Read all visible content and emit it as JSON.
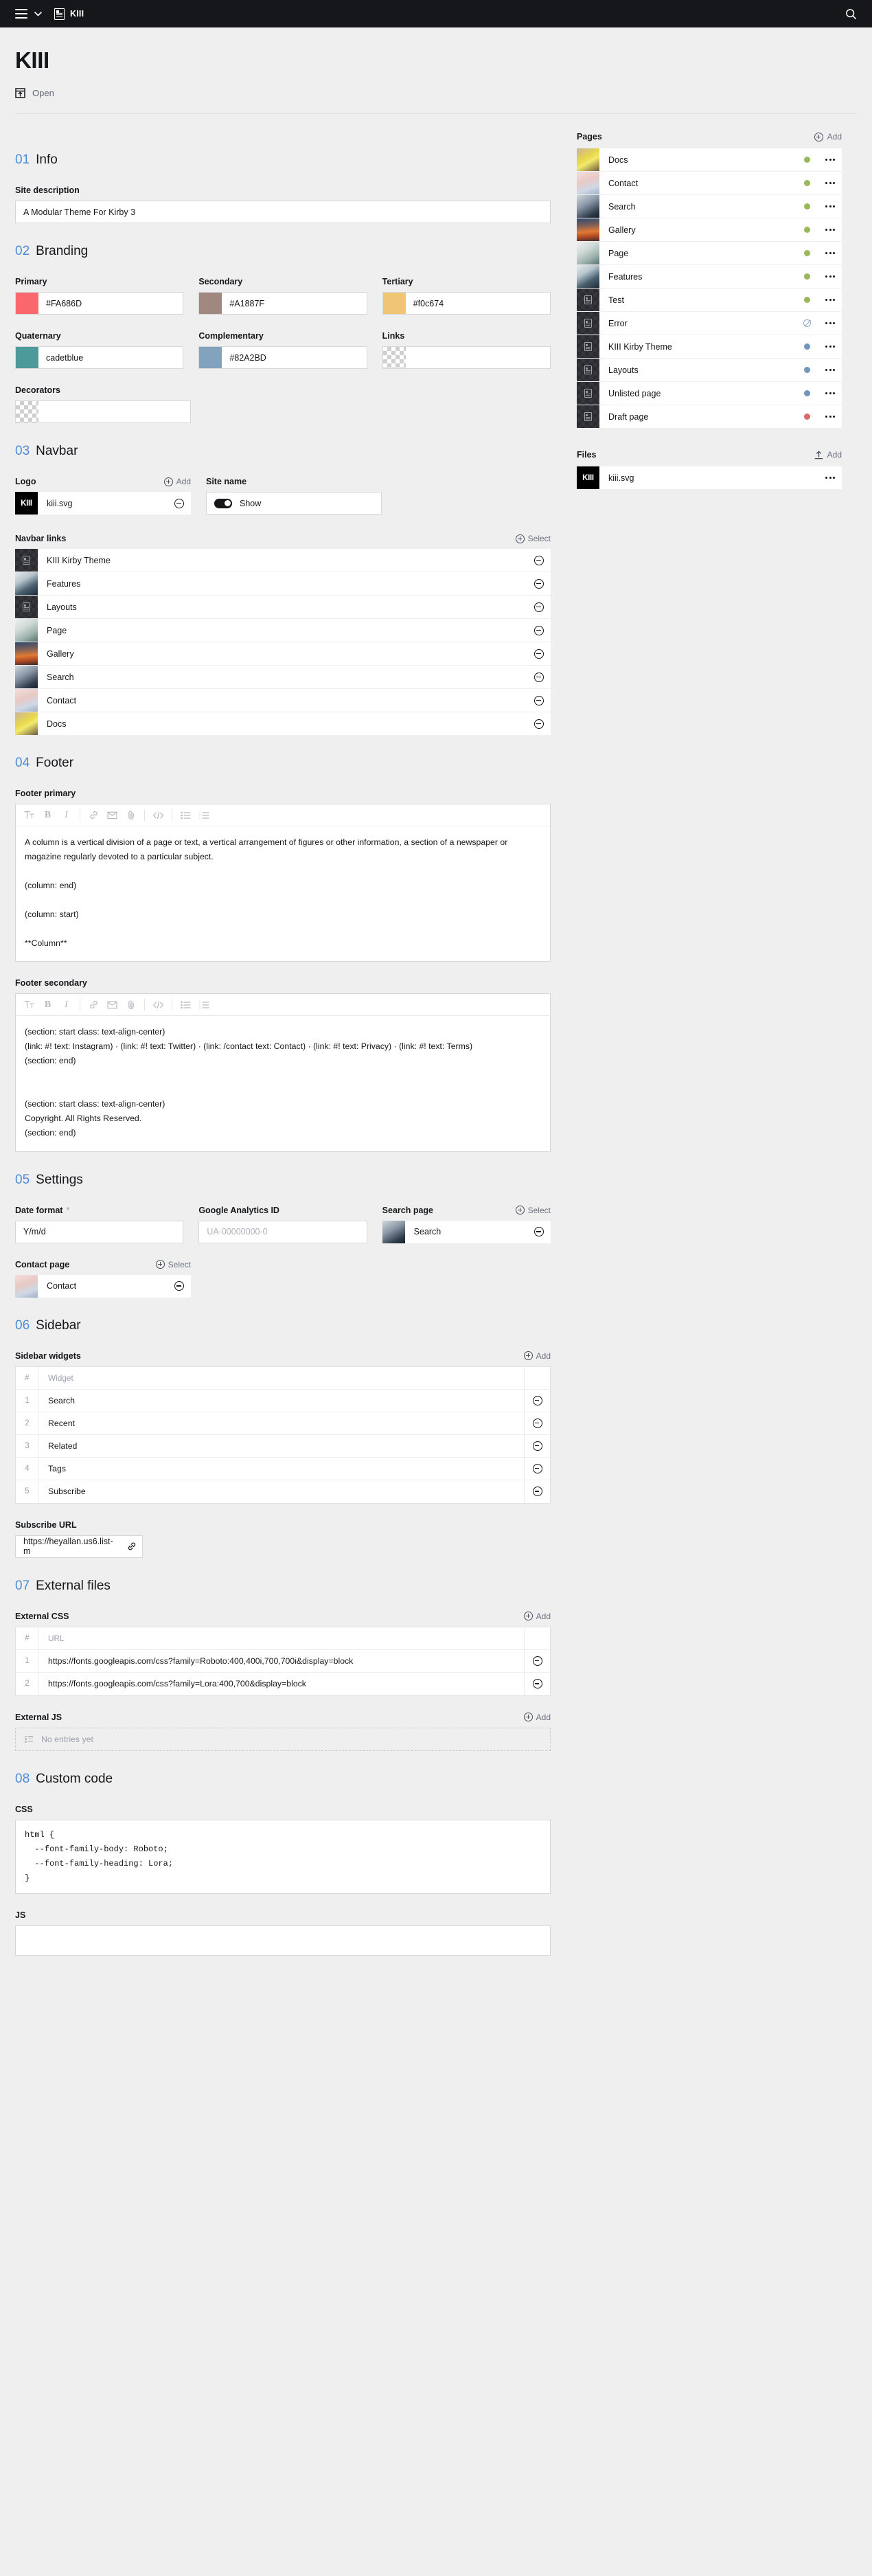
{
  "topbar": {
    "menu_icon": "hamburger-icon",
    "chevron_icon": "chevron-down-icon",
    "breadcrumb_icon": "page-document-icon",
    "breadcrumb_label": "KIII",
    "search_icon": "search-icon"
  },
  "header": {
    "title": "KIII",
    "open_icon": "open-external-icon",
    "open_label": "Open"
  },
  "sections": {
    "info": {
      "num": "01",
      "name": "Info"
    },
    "branding": {
      "num": "02",
      "name": "Branding"
    },
    "navbar": {
      "num": "03",
      "name": "Navbar"
    },
    "footer": {
      "num": "04",
      "name": "Footer"
    },
    "settings": {
      "num": "05",
      "name": "Settings"
    },
    "sidebar": {
      "num": "06",
      "name": "Sidebar"
    },
    "external": {
      "num": "07",
      "name": "External files"
    },
    "customcode": {
      "num": "08",
      "name": "Custom code"
    }
  },
  "info": {
    "site_description_label": "Site description",
    "site_description_value": "A Modular Theme For Kirby 3"
  },
  "branding": {
    "colors": [
      {
        "label": "Primary",
        "value": "#FA686D",
        "swatch": "#FA686D",
        "empty": false
      },
      {
        "label": "Secondary",
        "value": "#A1887F",
        "swatch": "#A1887F",
        "empty": false
      },
      {
        "label": "Tertiary",
        "value": "#f0c674",
        "swatch": "#F0C674",
        "empty": false
      },
      {
        "label": "Quaternary",
        "value": "cadetblue",
        "swatch": "#4E9A9A",
        "empty": false
      },
      {
        "label": "Complementary",
        "value": "#82A2BD",
        "swatch": "#82A2BD",
        "empty": false
      },
      {
        "label": "Links",
        "value": "",
        "swatch": "",
        "empty": true
      }
    ],
    "decorators_label": "Decorators",
    "decorators_value": ""
  },
  "navbar": {
    "logo_label": "Logo",
    "logo_add_label": "Add",
    "logo_file": "kiii.svg",
    "logo_thumb_text": "KIII",
    "sitename_label": "Site name",
    "sitename_toggle_label": "Show",
    "sitename_toggle_on": true,
    "links_label": "Navbar links",
    "links_action_label": "Select",
    "links": [
      {
        "label": "KIII Kirby Theme",
        "thumb": "dark"
      },
      {
        "label": "Features",
        "thumb": "features"
      },
      {
        "label": "Layouts",
        "thumb": "dark"
      },
      {
        "label": "Page",
        "thumb": "page"
      },
      {
        "label": "Gallery",
        "thumb": "gallery"
      },
      {
        "label": "Search",
        "thumb": "search"
      },
      {
        "label": "Contact",
        "thumb": "contact"
      },
      {
        "label": "Docs",
        "thumb": "docs"
      }
    ]
  },
  "footer": {
    "primary_label": "Footer primary",
    "secondary_label": "Footer secondary",
    "toolbar": [
      {
        "icon": "text-format-icon",
        "glyph": "Tᴛ"
      },
      {
        "icon": "bold-icon",
        "glyph": "B"
      },
      {
        "icon": "italic-icon",
        "glyph": "I"
      },
      {
        "icon": "link-icon",
        "glyph": "⧉"
      },
      {
        "icon": "email-icon",
        "glyph": "✉"
      },
      {
        "icon": "attachment-icon",
        "glyph": "📎"
      },
      {
        "icon": "code-icon",
        "glyph": "‹›"
      },
      {
        "icon": "bullet-list-icon",
        "glyph": "☰"
      },
      {
        "icon": "ordered-list-icon",
        "glyph": "☰"
      }
    ],
    "primary_text": "A column is a vertical division of a page or text, a vertical arrangement of figures or other information, a section of a newspaper or magazine regularly devoted to a particular subject.\n\n(column: end)\n\n(column: start)\n\n**Column**",
    "secondary_text": "(section: start class: text-align-center)\n(link: #! text: Instagram) · (link: #! text: Twitter) · (link: /contact text: Contact) · (link: #! text: Privacy) · (link: #! text: Terms)\n(section: end)\n\n\n(section: start class: text-align-center)\nCopyright. All Rights Reserved.\n(section: end)"
  },
  "settings": {
    "date_format_label": "Date format",
    "date_format_required": "*",
    "date_format_value": "Y/m/d",
    "ga_label": "Google Analytics ID",
    "ga_placeholder": "UA-00000000-0",
    "ga_value": "",
    "search_page_label": "Search page",
    "search_page_action": "Select",
    "search_page_value": "Search",
    "contact_page_label": "Contact page",
    "contact_page_action": "Select",
    "contact_page_value": "Contact"
  },
  "sidebar_section": {
    "widgets_label": "Sidebar widgets",
    "widgets_add_label": "Add",
    "col_index": "#",
    "col_widget": "Widget",
    "widgets": [
      {
        "index": "1",
        "name": "Search"
      },
      {
        "index": "2",
        "name": "Recent"
      },
      {
        "index": "3",
        "name": "Related"
      },
      {
        "index": "4",
        "name": "Tags"
      },
      {
        "index": "5",
        "name": "Subscribe"
      }
    ],
    "subscribe_url_label": "Subscribe URL",
    "subscribe_url_value": "https://heyallan.us6.list-m"
  },
  "external": {
    "css_label": "External CSS",
    "css_add_label": "Add",
    "col_index": "#",
    "col_url": "URL",
    "css_rows": [
      {
        "index": "1",
        "url": "https://fonts.googleapis.com/css?family=Roboto:400,400i,700,700i&display=block"
      },
      {
        "index": "2",
        "url": "https://fonts.googleapis.com/css?family=Lora:400,700&display=block"
      }
    ],
    "js_label": "External JS",
    "js_add_label": "Add",
    "js_empty_text": "No entries yet"
  },
  "custom_code": {
    "css_label": "CSS",
    "css_value": "html {\n  --font-family-body: Roboto;\n  --font-family-heading: Lora;\n}",
    "js_label": "JS",
    "js_value": ""
  },
  "pages_panel": {
    "title": "Pages",
    "add_label": "Add",
    "items": [
      {
        "label": "Docs",
        "thumb": "docs",
        "status": "listed",
        "status_color": "#9ab85a"
      },
      {
        "label": "Contact",
        "thumb": "contact",
        "status": "listed",
        "status_color": "#9ab85a"
      },
      {
        "label": "Search",
        "thumb": "search",
        "status": "listed",
        "status_color": "#9ab85a"
      },
      {
        "label": "Gallery",
        "thumb": "gallery",
        "status": "listed",
        "status_color": "#9ab85a"
      },
      {
        "label": "Page",
        "thumb": "page",
        "status": "listed",
        "status_color": "#9ab85a"
      },
      {
        "label": "Features",
        "thumb": "features",
        "status": "listed",
        "status_color": "#9ab85a"
      },
      {
        "label": "Test",
        "thumb": "dark",
        "status": "listed",
        "status_color": "#9ab85a"
      },
      {
        "label": "Error",
        "thumb": "dark",
        "status": "blocked",
        "status_color": "#8aa7c6"
      },
      {
        "label": "KIII Kirby Theme",
        "thumb": "dark",
        "status": "unlisted",
        "status_color": "#7195bd"
      },
      {
        "label": "Layouts",
        "thumb": "dark",
        "status": "unlisted",
        "status_color": "#7195bd"
      },
      {
        "label": "Unlisted page",
        "thumb": "dark",
        "status": "unlisted",
        "status_color": "#7195bd"
      },
      {
        "label": "Draft page",
        "thumb": "dark",
        "status": "draft",
        "status_color": "#d96a6a"
      }
    ]
  },
  "files_panel": {
    "title": "Files",
    "add_label": "Add",
    "items": [
      {
        "label": "kiii.svg",
        "thumb_text": "KIII"
      }
    ]
  }
}
